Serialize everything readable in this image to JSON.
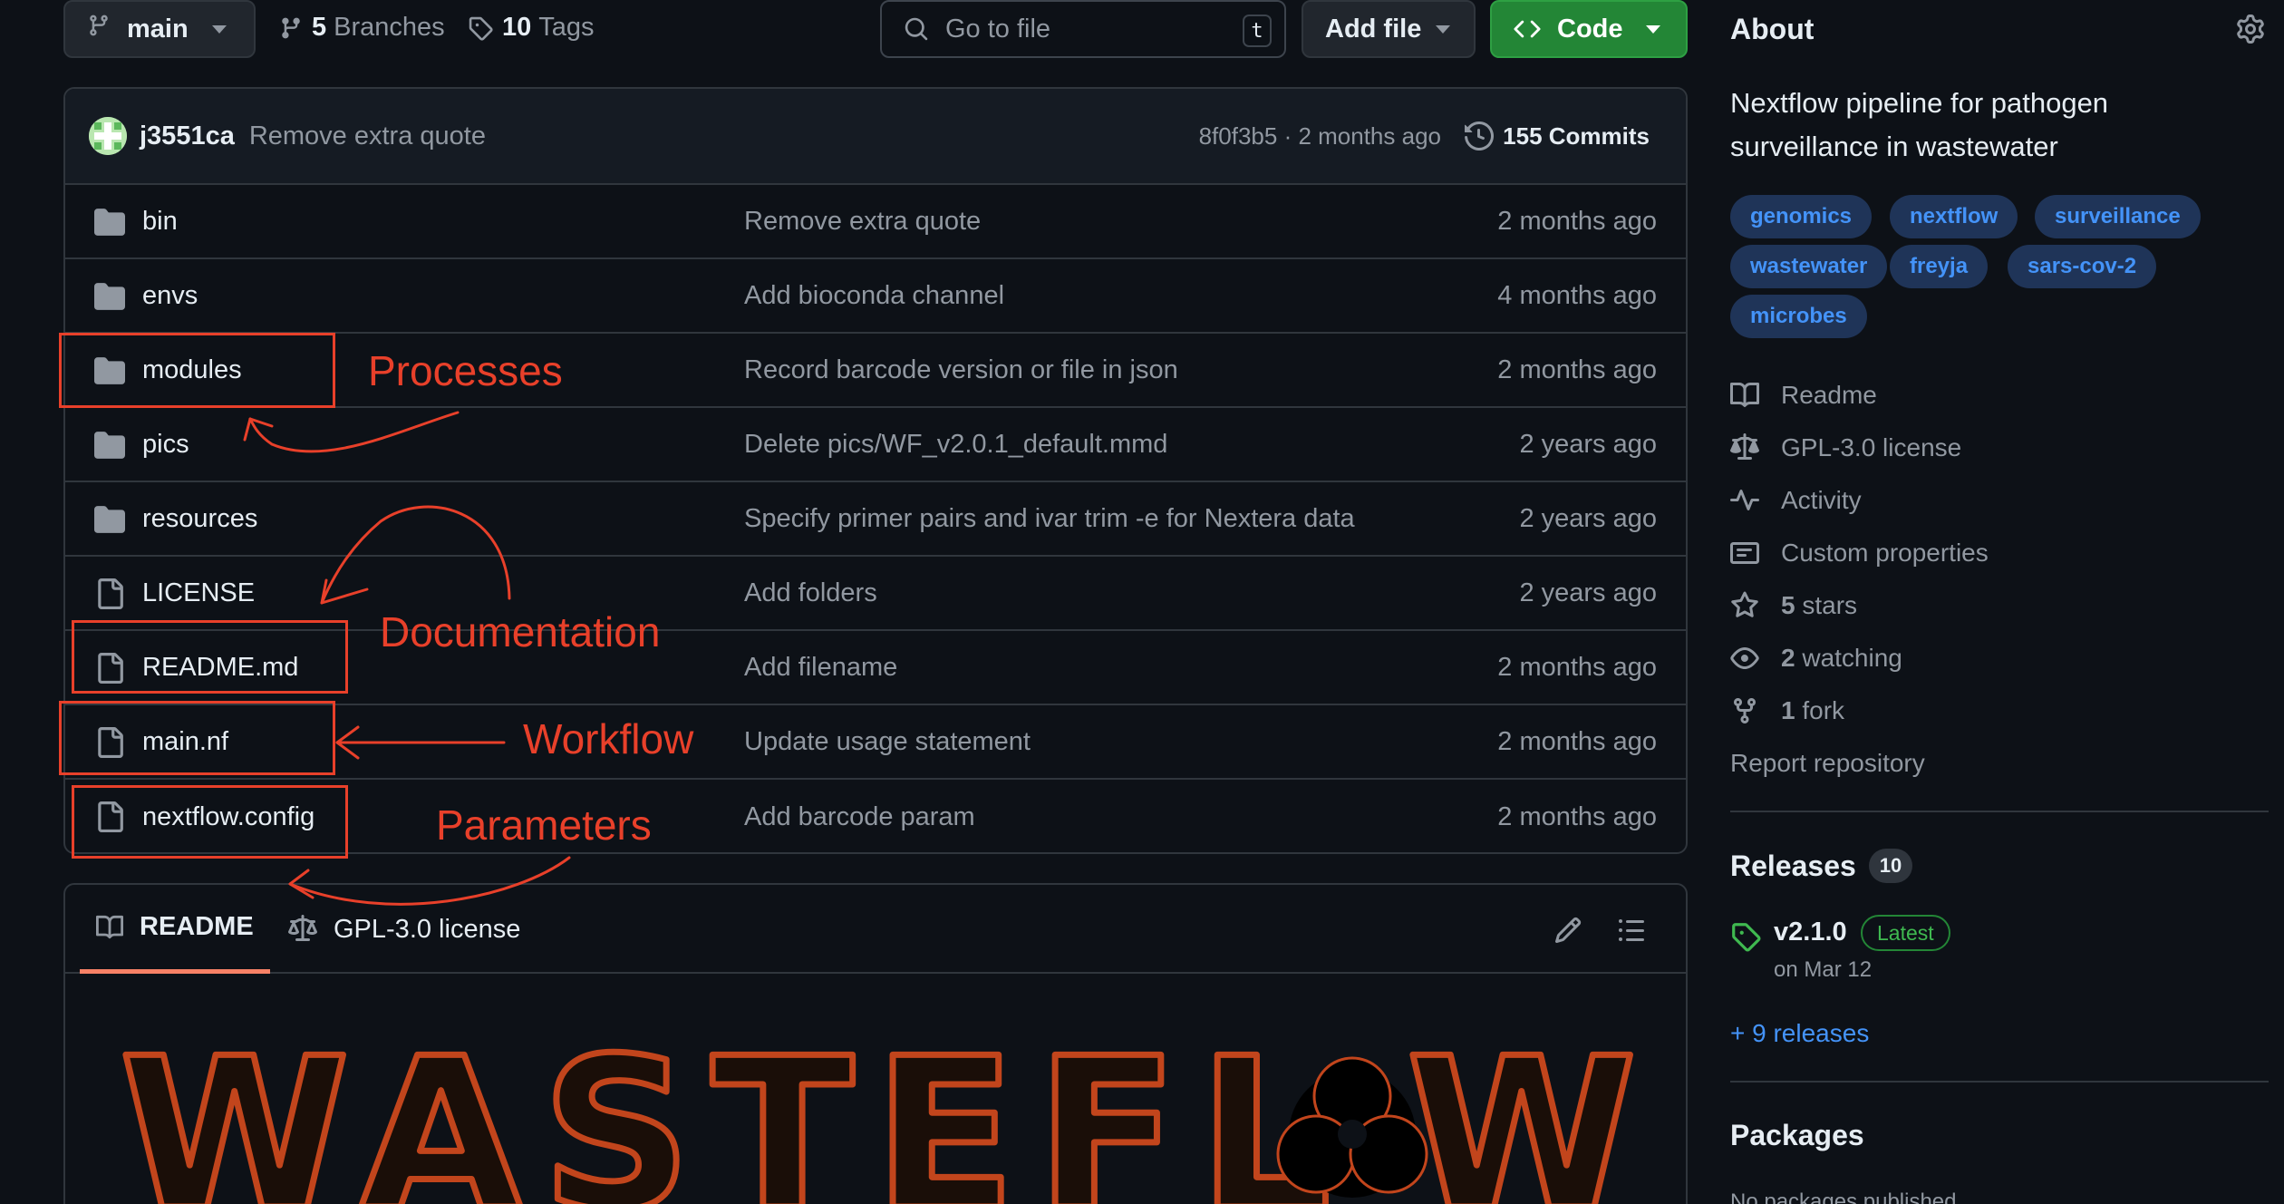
{
  "toolbar": {
    "branch": "main",
    "branches_count": "5",
    "branches_label": "Branches",
    "tags_count": "10",
    "tags_label": "Tags",
    "search_placeholder": "Go to file",
    "search_shortcut": "t",
    "add_file_label": "Add file",
    "code_label": "Code"
  },
  "commit": {
    "author": "j3551ca",
    "message": "Remove extra quote",
    "meta": "8f0f3b5 · 2 months ago",
    "commits_label": "155 Commits"
  },
  "files": [
    {
      "name": "bin",
      "type": "folder",
      "message": "Remove extra quote",
      "date": "2 months ago"
    },
    {
      "name": "envs",
      "type": "folder",
      "message": "Add bioconda channel",
      "date": "4 months ago"
    },
    {
      "name": "modules",
      "type": "folder",
      "message": "Record barcode version or file in json",
      "date": "2 months ago"
    },
    {
      "name": "pics",
      "type": "folder",
      "message": "Delete pics/WF_v2.0.1_default.mmd",
      "date": "2 years ago"
    },
    {
      "name": "resources",
      "type": "folder",
      "message": "Specify primer pairs and ivar trim -e for Nextera data",
      "date": "2 years ago"
    },
    {
      "name": "LICENSE",
      "type": "file",
      "message": "Add folders",
      "date": "2 years ago"
    },
    {
      "name": "README.md",
      "type": "file",
      "message": "Add filename",
      "date": "2 months ago"
    },
    {
      "name": "main.nf",
      "type": "file",
      "message": "Update usage statement",
      "date": "2 months ago"
    },
    {
      "name": "nextflow.config",
      "type": "file",
      "message": "Add barcode param",
      "date": "2 months ago"
    }
  ],
  "readme": {
    "tab_readme": "README",
    "tab_license": "GPL-3.0 license",
    "logo_text": "WASTEFLOW"
  },
  "annotations": {
    "processes": "Processes",
    "documentation": "Documentation",
    "workflow": "Workflow",
    "parameters": "Parameters",
    "color": "#e8402a"
  },
  "about": {
    "title": "About",
    "description": "Nextflow pipeline for pathogen surveillance in wastewater",
    "topics": [
      "genomics",
      "nextflow",
      "surveillance",
      "wastewater",
      "freyja",
      "sars-cov-2",
      "microbes"
    ],
    "readme_link": "Readme",
    "license_link": "GPL-3.0 license",
    "activity_link": "Activity",
    "custom_props_link": "Custom properties",
    "stars_count": "5",
    "stars_label": "stars",
    "watching_count": "2",
    "watching_label": "watching",
    "fork_count": "1",
    "fork_label": "fork",
    "report_link": "Report repository"
  },
  "releases": {
    "title": "Releases",
    "count": "10",
    "version": "v2.1.0",
    "latest_badge": "Latest",
    "date": "on Mar 12",
    "more_link": "+ 9 releases"
  },
  "packages": {
    "title": "Packages",
    "empty_text": "No packages published"
  },
  "colors": {
    "background": "#0d1117",
    "accent_link": "#4493f8",
    "code_button": "#238636",
    "annotation": "#e8402a"
  }
}
